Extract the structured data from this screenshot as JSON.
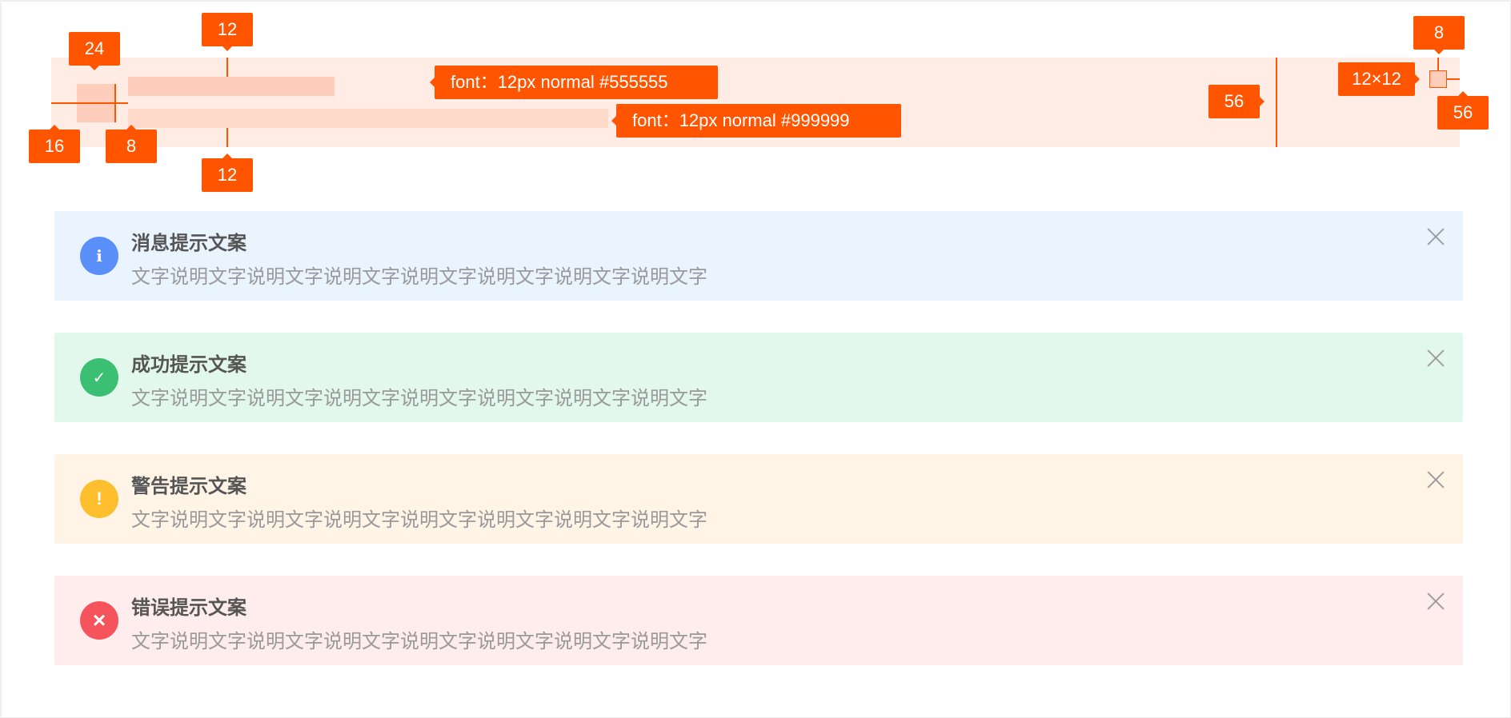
{
  "spec": {
    "icon_size": "24",
    "left_padding": "16",
    "icon_gap": "8",
    "top_padding": "12",
    "bottom_padding": "12",
    "title_font": "font：12px normal  #555555",
    "desc_font": "font：12px normal  #999999",
    "close_area_width": "56",
    "close_top_offset": "8",
    "close_size": "12×12",
    "close_right_area": "56"
  },
  "alerts": [
    {
      "type": "info",
      "title": "消息提示文案",
      "desc": "文字说明文字说明文字说明文字说明文字说明文字说明文字说明文字",
      "icon": "info-icon",
      "glyph": "i",
      "bg": "#e9f4ff",
      "icon_color": "#5b8ff9"
    },
    {
      "type": "success",
      "title": "成功提示文案",
      "desc": "文字说明文字说明文字说明文字说明文字说明文字说明文字说明文字",
      "icon": "check-icon",
      "glyph": "✓",
      "bg": "#e3f8ec",
      "icon_color": "#3bbf73"
    },
    {
      "type": "warning",
      "title": "警告提示文案",
      "desc": "文字说明文字说明文字说明文字说明文字说明文字说明文字说明文字",
      "icon": "exclamation-icon",
      "glyph": "!",
      "bg": "#fff4e6",
      "icon_color": "#fdbf2d"
    },
    {
      "type": "error",
      "title": "错误提示文案",
      "desc": "文字说明文字说明文字说明文字说明文字说明文字说明文字说明文字",
      "icon": "error-x-icon",
      "glyph": "×",
      "bg": "#ffecec",
      "icon_color": "#f5545c"
    }
  ],
  "colors": {
    "annotation": "#ff5500",
    "title": "#555555",
    "desc": "#999999"
  }
}
